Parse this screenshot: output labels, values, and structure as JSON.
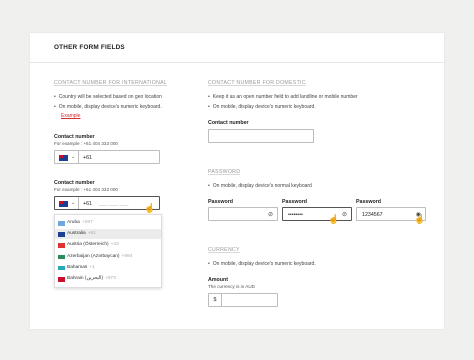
{
  "card": {
    "title": "OTHER FORM FIELDS"
  },
  "intl": {
    "section_title": "CONTACT NUMBER FOR INTERNATIONAL",
    "bullets": [
      "Country will be selected based on geo location",
      "On mobile, display device's numeric keyboard."
    ],
    "example_link": "Example",
    "field1": {
      "label": "Contact number",
      "hint": "For example : +61 404 333 000",
      "value": "+61",
      "flag": "Australia"
    },
    "field2": {
      "label": "Contact number",
      "hint": "For example : +61 404 333 000",
      "prefix": "+61",
      "placeholder": "___ ___ ___",
      "flag": "Australia"
    },
    "dropdown": [
      {
        "name": "Aruba",
        "code": "+297",
        "color": "#6fa8dc"
      },
      {
        "name": "Australia",
        "code": "+61",
        "color": "#1c3f94",
        "selected": true
      },
      {
        "name": "Austria (Österreich)",
        "code": "+43",
        "color": "#d33"
      },
      {
        "name": "Azerbaijan (Azərbaycan)",
        "code": "+994",
        "color": "#2a8b57"
      },
      {
        "name": "Bahamas",
        "code": "+1",
        "color": "#2aa9b8"
      },
      {
        "name": "Bahrain (‫البحرين‬‎)",
        "code": "+973",
        "color": "#c8102e"
      }
    ]
  },
  "domestic": {
    "section_title": "CONTACT NUMBER FOR DOMESTIC",
    "bullets": [
      "Keep it as an open number field to add landline or mobile number",
      "On mobile, display device's numeric keyboard."
    ],
    "label": "Contact number",
    "value": ""
  },
  "password": {
    "section_title": "PASSWORD",
    "bullets": [
      "On mobile, display device's normal keyboard"
    ],
    "fields": [
      {
        "label": "Password",
        "value": ""
      },
      {
        "label": "Password",
        "value": "••••••••"
      },
      {
        "label": "Password",
        "value": "1234567"
      }
    ]
  },
  "currency": {
    "section_title": "CURRENCY",
    "bullets": [
      "On mobile, display device's numeric keyboard."
    ],
    "label": "Amount",
    "hint": "The currency is in AUD",
    "prefix": "$",
    "value": ""
  },
  "icons": {
    "eye": "eye-slash-icon",
    "caret": "chevron-down-icon",
    "cursor": "hand-pointer-icon"
  }
}
